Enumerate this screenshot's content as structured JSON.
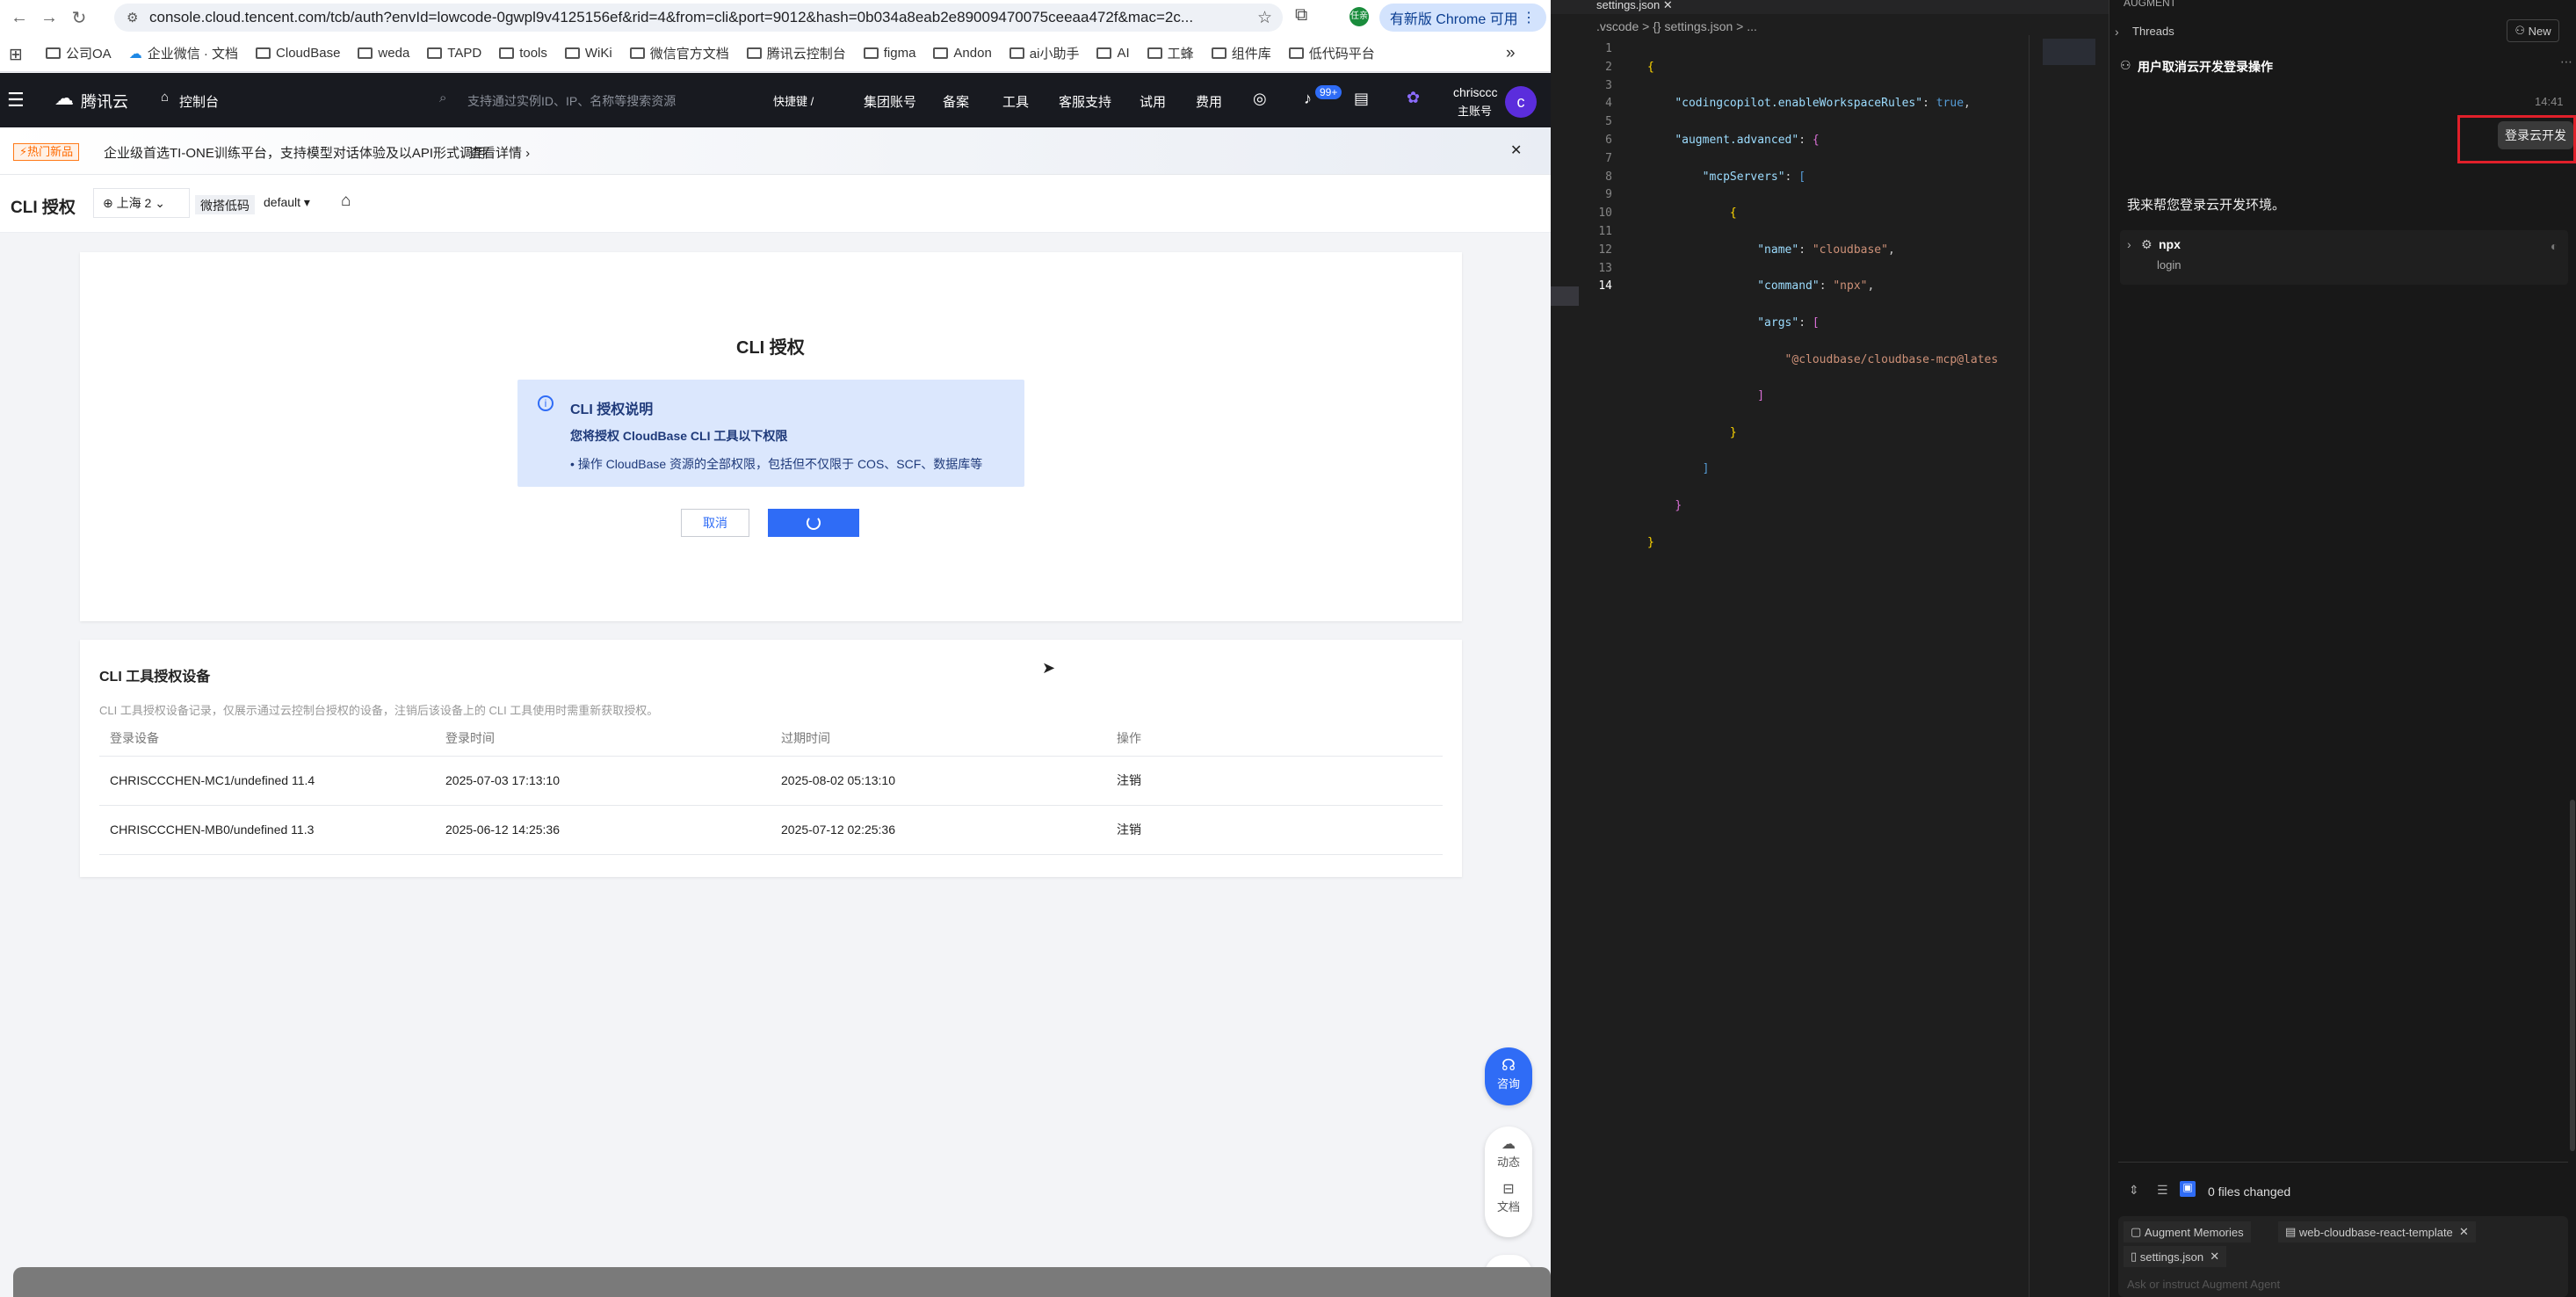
{
  "browser": {
    "url": "console.cloud.tencent.com/tcb/auth?envId=lowcode-0gwpl9v4125156ef&rid=4&from=cli&port=9012&hash=0b034a8eab2e89009470075ceeaa472f&mac=2c...",
    "update_label": "有新版 Chrome 可用",
    "profile_label": "任亲",
    "bookmarks": [
      "公司OA",
      "企业微信 · 文档",
      "CloudBase",
      "weda",
      "TAPD",
      "tools",
      "WiKi",
      "微信官方文档",
      "腾讯云控制台",
      "figma",
      "Andon",
      "ai小助手",
      "AI",
      "工蜂",
      "组件库",
      "低代码平台"
    ],
    "more_label": "»"
  },
  "topnav": {
    "brand": "腾讯云",
    "console_label": "控制台",
    "search_placeholder": "支持通过实例ID、IP、名称等搜索资源",
    "shortcut": "快捷键 /",
    "items": [
      "集团账号",
      "备案",
      "工具",
      "客服支持",
      "试用",
      "费用"
    ],
    "badge": "99+",
    "user_name": "chrisccc",
    "user_role": "主账号",
    "avatar_letter": "c"
  },
  "banner": {
    "hot_label": "⚡热门新品",
    "text": "企业级首选TI-ONE训练平台，支持模型对话体验及以API形式调用",
    "link": "查看详情",
    "close": "✕"
  },
  "titlebar": {
    "title": "CLI 授权",
    "region": "上海 2",
    "env_label": "微搭低码",
    "env_value": "default"
  },
  "auth_card": {
    "title": "CLI 授权",
    "info_title": "CLI 授权说明",
    "info_desc": "您将授权 CloudBase CLI 工具以下权限",
    "info_bullet": "• 操作 CloudBase 资源的全部权限，包括但不仅限于 COS、SCF、数据库等",
    "cancel_label": "取消"
  },
  "devices": {
    "title": "CLI 工具授权设备",
    "desc": "CLI 工具授权设备记录，仅展示通过云控制台授权的设备，注销后该设备上的 CLI 工具使用时需重新获取授权。",
    "columns": [
      "登录设备",
      "登录时间",
      "过期时间",
      "操作"
    ],
    "rows": [
      {
        "device": "CHRISCCCHEN-MC1/undefined 11.4",
        "login": "2025-07-03 17:13:10",
        "expire": "2025-08-02 05:13:10",
        "action": "注销"
      },
      {
        "device": "CHRISCCCHEN-MB0/undefined 11.3",
        "login": "2025-06-12 14:25:36",
        "expire": "2025-07-12 02:25:36",
        "action": "注销"
      }
    ]
  },
  "floating": {
    "consult": "咨询",
    "dynamic": "动态",
    "docs": "文档"
  },
  "editor": {
    "tab": "settings.json",
    "breadcrumb": ".vscode > {} settings.json > ...",
    "line_numbers": [
      "1",
      "2",
      "3",
      "4",
      "5",
      "6",
      "7",
      "8",
      "9",
      "10",
      "11",
      "12",
      "13",
      "14"
    ],
    "json": {
      "key_rules": "\"codingcopilot.enableWorkspaceRules\"",
      "val_true": "true",
      "key_augment": "\"augment.advanced\"",
      "key_mcp": "\"mcpServers\"",
      "key_name": "\"name\"",
      "val_name": "\"cloudbase\"",
      "key_cmd": "\"command\"",
      "val_cmd": "\"npx\"",
      "key_args": "\"args\"",
      "val_arg": "\"@cloudbase/cloudbase-mcp@lates"
    }
  },
  "panel": {
    "header": "AUGMENT",
    "threads": "Threads",
    "new_label": "New",
    "thread_title": "用户取消云开发登录操作",
    "time": "14:41",
    "user_msg": "登录云开发",
    "assistant_msg": "我来帮您登录云开发环境。",
    "tool_name": "npx",
    "tool_arg": "login",
    "files_changed": "0 files changed",
    "chip_memories": "Augment Memories",
    "chip_template": "web-cloudbase-react-template",
    "chip_settings": "settings.json",
    "input_placeholder": "Ask or instruct Augment Agent"
  }
}
